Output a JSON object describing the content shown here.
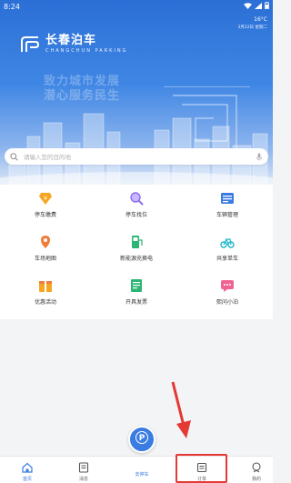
{
  "status_bar": {
    "time": "8:24"
  },
  "weather": {
    "temp": "16°C",
    "date": "3月22日 星期二"
  },
  "brand": {
    "name_cn": "长春泊车",
    "name_en": "CHANGCHUN PARKING"
  },
  "slogan": {
    "line1": "致力城市发展",
    "line2": "潜心服务民生"
  },
  "search": {
    "placeholder": "请输入您的目的地",
    "icon": "search-icon",
    "voice_icon": "mic-icon"
  },
  "services": [
    {
      "label": "停车缴费",
      "icon": "parking-payment-icon",
      "color": "#f5a623"
    },
    {
      "label": "停车找位",
      "icon": "find-spot-icon",
      "color": "#8c6df0"
    },
    {
      "label": "车辆管理",
      "icon": "vehicle-manage-icon",
      "color": "#3b7ce3"
    },
    {
      "label": "车场地图",
      "icon": "lot-map-icon",
      "color": "#f07c3a"
    },
    {
      "label": "新能源充换电",
      "icon": "ev-charging-icon",
      "color": "#2bb673"
    },
    {
      "label": "共享单车",
      "icon": "shared-bike-icon",
      "color": "#1fb6c9"
    },
    {
      "label": "优惠活动",
      "icon": "promotion-icon",
      "color": "#f5a623"
    },
    {
      "label": "开具发票",
      "icon": "invoice-icon",
      "color": "#2bb673"
    },
    {
      "label": "熙问小泊",
      "icon": "chat-assistant-icon",
      "color": "#f06292"
    }
  ],
  "tabbar": {
    "home": "首页",
    "messages": "消息",
    "park": "去停车",
    "orders": "订单",
    "mine": "我的"
  },
  "colors": {
    "accent": "#3b7ce3",
    "highlight": "#e53935"
  }
}
